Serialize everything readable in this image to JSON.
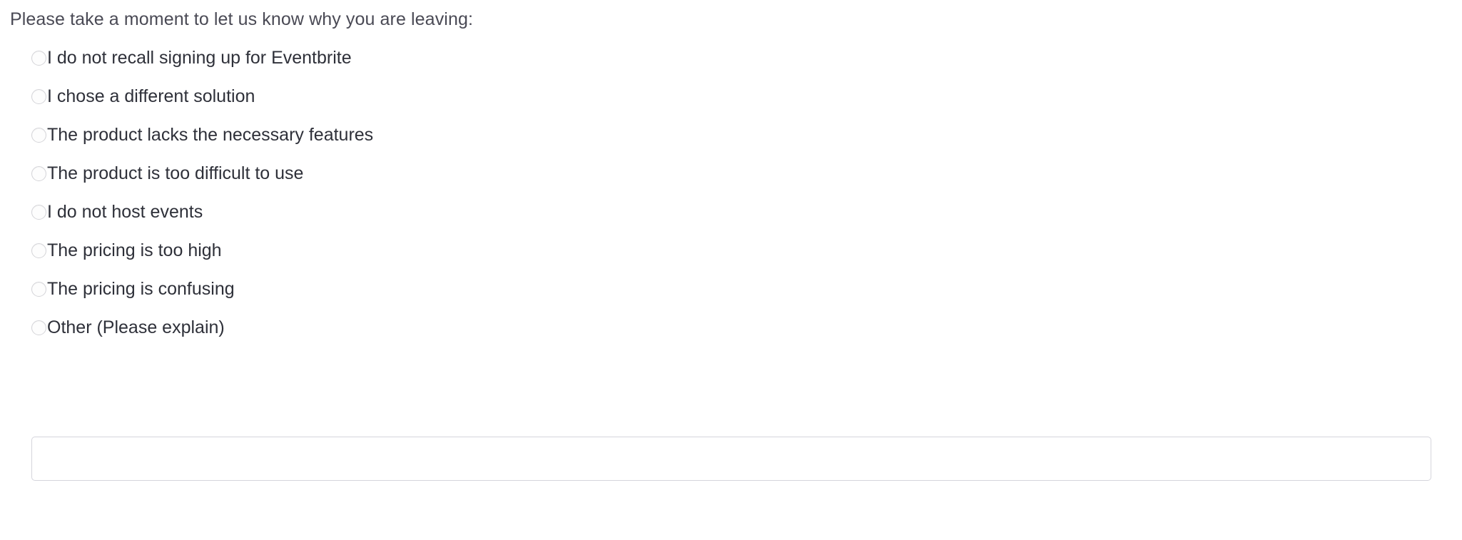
{
  "survey": {
    "prompt": "Please take a moment to let us know why you are leaving:",
    "options": [
      {
        "id": "not-recall-signup",
        "label": "I do not recall signing up for Eventbrite",
        "selected": false
      },
      {
        "id": "chose-different-solution",
        "label": "I chose a different solution",
        "selected": false
      },
      {
        "id": "lacks-features",
        "label": "The product lacks the necessary features",
        "selected": false
      },
      {
        "id": "too-difficult",
        "label": "The product is too difficult to use",
        "selected": false
      },
      {
        "id": "do-not-host-events",
        "label": "I do not host events",
        "selected": false
      },
      {
        "id": "pricing-too-high",
        "label": "The pricing is too high",
        "selected": false
      },
      {
        "id": "pricing-confusing",
        "label": "The pricing is confusing",
        "selected": false
      },
      {
        "id": "other",
        "label": "Other (Please explain)",
        "selected": false
      }
    ],
    "explain_field": {
      "value": "",
      "placeholder": ""
    }
  },
  "colors": {
    "page_background": "#ffffff",
    "prompt_text": "#4a4a55",
    "option_text": "#2e3039",
    "radio_border": "#d4d4d8",
    "input_border": "#d5d5dc"
  }
}
